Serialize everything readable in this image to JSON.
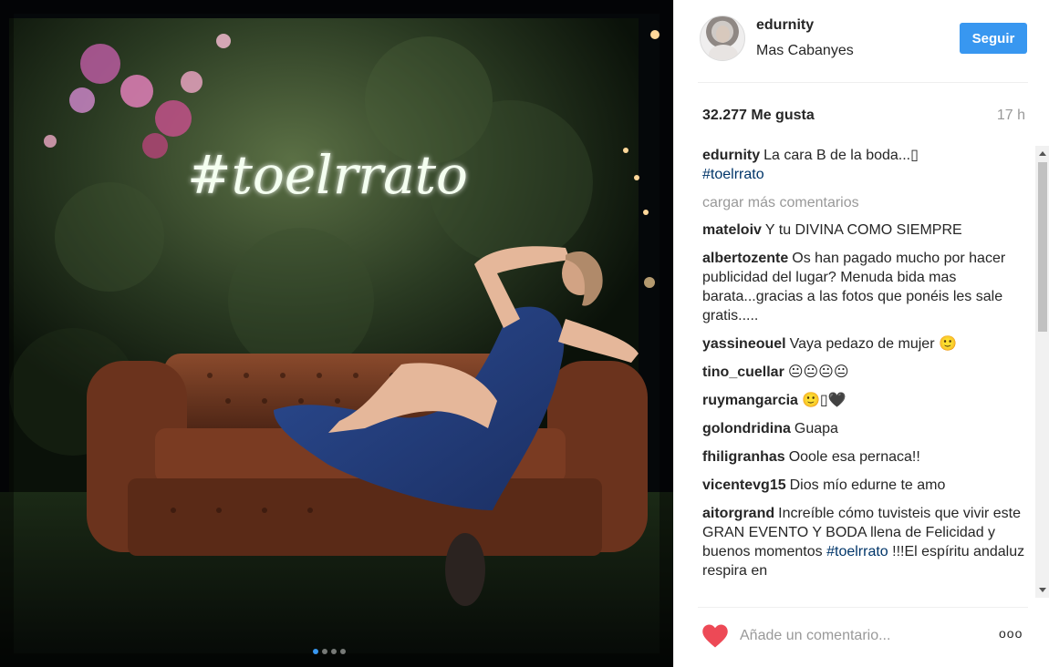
{
  "photo": {
    "neon_text": "#toelrrato",
    "carousel_dots": 4,
    "carousel_active_index": 0
  },
  "header": {
    "username": "edurnity",
    "location": "Mas Cabanyes",
    "follow_label": "Seguir"
  },
  "stats": {
    "likes": "32.277 Me gusta",
    "time": "17 h"
  },
  "caption": {
    "user": "edurnity",
    "text": "La cara B de la boda...▯",
    "hashtag": "#toelrrato"
  },
  "load_more": "cargar más comentarios",
  "comments": [
    {
      "user": "mateloiv",
      "text": "Y tu DIVINA COMO SIEMPRE"
    },
    {
      "user": "albertozente",
      "text": "Os han pagado mucho por hacer publicidad del lugar? Menuda bida mas barata...gracias a las fotos que ponéis les sale gratis....."
    },
    {
      "user": "yassineouel",
      "text": "Vaya pedazo de mujer 🙂"
    },
    {
      "user": "tino_cuellar",
      "text": "😐😐😐😐"
    },
    {
      "user": "ruymangarcia",
      "text": "🙂▯🖤"
    },
    {
      "user": "golondridina",
      "text": "Guapa"
    },
    {
      "user": "fhiligranhas",
      "text": "Ooole esa pernaca!!"
    },
    {
      "user": "vicentevg15",
      "text": "Dios mío edurne te amo"
    },
    {
      "user": "aitorgrand",
      "text": "Increíble cómo tuvisteis que vivir este GRAN EVENTO Y BODA llena de Felicidad y buenos momentos",
      "hashtag": "#toelrrato",
      "text2": " !!!El espíritu andaluz respira en"
    }
  ],
  "footer": {
    "comment_placeholder": "Añade un comentario...",
    "more_label": "ooo"
  },
  "colors": {
    "accent": "#3897f0",
    "heart": "#ed4956",
    "hashtag": "#003569"
  },
  "icons": {
    "like": "heart-icon",
    "more": "more-options-icon"
  }
}
